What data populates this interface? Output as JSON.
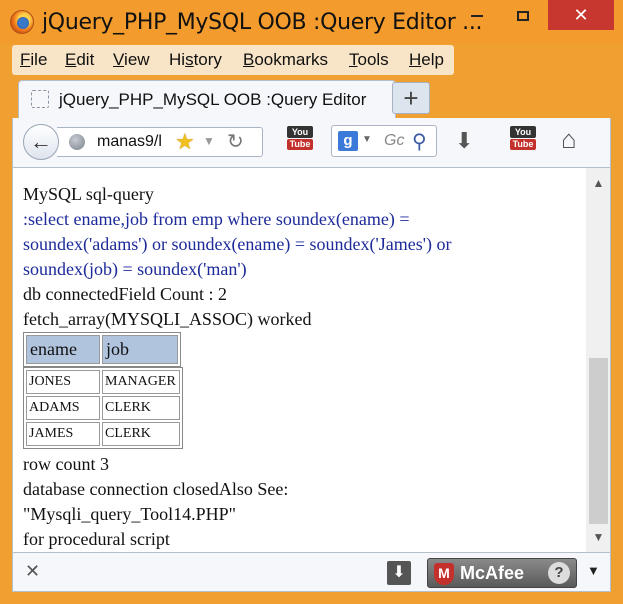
{
  "window": {
    "title": "jQuery_PHP_MySQL OOB :Query Editor ...",
    "minimize_icon": "minimize-icon",
    "maximize_icon": "maximize-icon",
    "close_label": "✕"
  },
  "menu": {
    "items": [
      {
        "label": "File",
        "accel": "F",
        "rest": "ile"
      },
      {
        "label": "Edit",
        "accel": "E",
        "rest": "dit"
      },
      {
        "label": "View",
        "accel": "V",
        "rest": "iew"
      },
      {
        "label": "History",
        "accel": "s",
        "pre": "Hi",
        "rest": "tory"
      },
      {
        "label": "Bookmarks",
        "accel": "B",
        "rest": "ookmarks"
      },
      {
        "label": "Tools",
        "accel": "T",
        "rest": "ools"
      },
      {
        "label": "Help",
        "accel": "H",
        "rest": "elp"
      }
    ]
  },
  "tab": {
    "label": "jQuery_PHP_MySQL OOB :Query Editor",
    "new_tab_label": "+"
  },
  "nav": {
    "url": "manas9/l",
    "search_placeholder": "Gc",
    "youtube_label_top": "You",
    "youtube_label_bottom": "Tube"
  },
  "content": {
    "line1": "MySQL sql-query",
    "query1": ":select ename,job from emp where soundex(ename) =",
    "query2": "soundex('adams') or soundex(ename) = soundex('James') or",
    "query3": "soundex(job) = soundex('man')",
    "status1": "db connectedField Count : 2",
    "status2": "fetch_array(MYSQLI_ASSOC) worked",
    "headers": [
      "ename",
      "job"
    ],
    "rows": [
      [
        "JONES",
        "MANAGER"
      ],
      [
        "ADAMS",
        "CLERK"
      ],
      [
        "JAMES",
        "CLERK"
      ]
    ],
    "row_count": "row count 3",
    "closed": "database connection closedAlso See:",
    "see_file": "\"Mysqli_query_Tool14.PHP\"",
    "procedural": "for procedural script"
  },
  "addon_bar": {
    "close_label": "✕",
    "mcafee_label": "McAfee",
    "help_label": "?"
  },
  "colors": {
    "titlebar": "#f39c2d",
    "table_header": "#b0c4de",
    "query_text": "#1c2a9a"
  }
}
